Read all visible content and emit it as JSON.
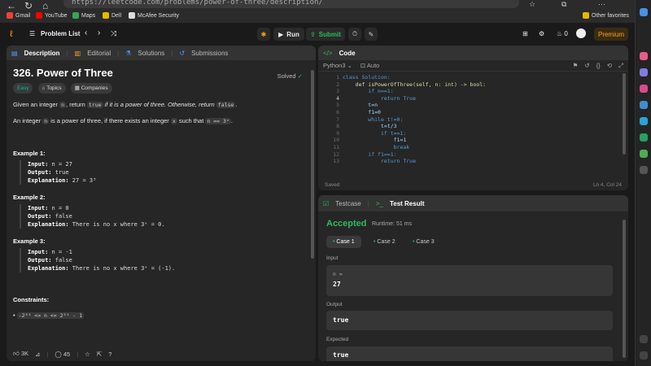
{
  "browser": {
    "url": "https://leetcode.com/problems/power-of-three/description/",
    "bookmarks": [
      "Gmail",
      "YouTube",
      "Maps",
      "Dell",
      "McAfee Security"
    ],
    "other_favorites": "Other favorites"
  },
  "lc_bar": {
    "problem_list": "Problem List",
    "run": "Run",
    "submit": "Submit",
    "fire_count": "0",
    "premium": "Premium"
  },
  "desc_tabs": [
    "Description",
    "Editorial",
    "Solutions",
    "Submissions"
  ],
  "problem": {
    "title": "326. Power of Three",
    "solved": "Solved",
    "tags": [
      "Easy",
      "Topics",
      "Companies"
    ],
    "p1_a": "Given an integer ",
    "p1_code": "n",
    "p1_b": ", return ",
    "p1_code2": "true",
    "p1_c": " if it is a power of three. Otherwise, return ",
    "p1_code3": "false",
    "p1_d": ".",
    "p2_a": "An integer ",
    "p2_code": "n",
    "p2_b": " is a power of three, if there exists an integer ",
    "p2_code2": "x",
    "p2_c": " such that ",
    "p2_code3": "n == 3ˣ",
    "p2_d": ".",
    "examples": [
      {
        "title": "Example 1:",
        "input": "n = 27",
        "output": "true",
        "explanation": "27 = 3³"
      },
      {
        "title": "Example 2:",
        "input": "n = 0",
        "output": "false",
        "explanation": "There is no x where 3ˣ = 0."
      },
      {
        "title": "Example 3:",
        "input": "n = -1",
        "output": "false",
        "explanation": "There is no x where 3ˣ = (-1)."
      }
    ],
    "labels": {
      "input": "Input:",
      "output": "Output:",
      "explanation": "Explanation:"
    },
    "constraints_title": "Constraints:",
    "constraint": "-2³¹ <= n <= 2³¹ - 1"
  },
  "desc_footer": {
    "likes": "3K",
    "comments": "45"
  },
  "code_panel": {
    "title": "Code",
    "language": "Python3",
    "auto": "Auto",
    "lines": [
      "class Solution:",
      "    def isPowerOfThree(self, n: int) -> bool:",
      "        if n==1:",
      "            return True",
      "        t=n",
      "        f1=0",
      "        while t!=0:",
      "            t=t/3",
      "            if t==1:",
      "                f1=1",
      "                break",
      "        if f1==1:",
      "            return True"
    ],
    "line_numbers": [
      "1",
      "2",
      "3",
      "4",
      "5",
      "6",
      "7",
      "8",
      "9",
      "10",
      "11",
      "12",
      "13"
    ],
    "saved": "Saved",
    "cursor": "Ln 4, Col 24"
  },
  "test_panel": {
    "tab_testcase": "Testcase",
    "tab_result": "Test Result",
    "status": "Accepted",
    "runtime": "Runtime: 51 ms",
    "cases": [
      "Case 1",
      "Case 2",
      "Case 3"
    ],
    "input_label": "Input",
    "var_label": "n =",
    "input_value": "27",
    "output_label": "Output",
    "output_value": "true",
    "expected_label": "Expected",
    "expected_value": "true"
  },
  "colors": {
    "accent": "#2cbb5d",
    "premium": "#ffa116",
    "easy": "#00b8a3"
  }
}
